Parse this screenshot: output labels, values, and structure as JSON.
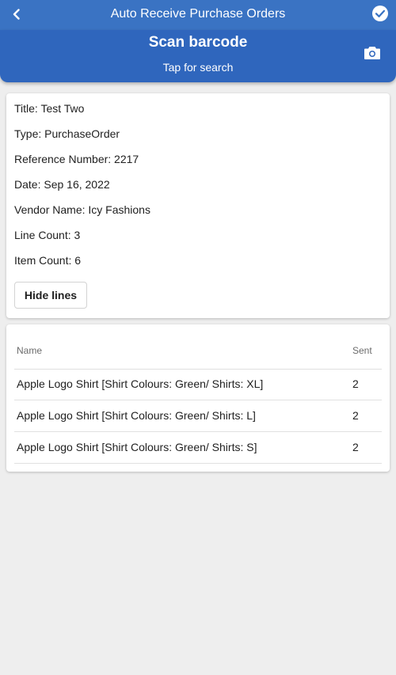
{
  "header": {
    "title": "Auto Receive Purchase Orders"
  },
  "scan": {
    "title": "Scan barcode",
    "subtitle": "Tap for search"
  },
  "order": {
    "title": "Title: Test Two",
    "type": "Type: PurchaseOrder",
    "reference": "Reference Number: 2217",
    "date": "Date: Sep 16, 2022",
    "vendor": "Vendor Name: Icy Fashions",
    "line_count": "Line Count: 3",
    "item_count": "Item Count: 6",
    "hide_lines_label": "Hide lines"
  },
  "lines_table": {
    "columns": [
      "Name",
      "Sent"
    ],
    "rows": [
      {
        "name": "Apple Logo Shirt [Shirt Colours: Green/ Shirts: XL]",
        "sent": "2"
      },
      {
        "name": "Apple Logo Shirt [Shirt Colours: Green/ Shirts: L]",
        "sent": "2"
      },
      {
        "name": "Apple Logo Shirt [Shirt Colours: Green/ Shirts: S]",
        "sent": "2"
      }
    ]
  },
  "colors": {
    "header_bg": "#3a73c3",
    "scan_bg": "#2f66bd",
    "page_bg": "#eeeeee"
  },
  "icons": {
    "back": "chevron-left-icon",
    "confirm": "check-circle-icon",
    "camera": "camera-icon"
  }
}
